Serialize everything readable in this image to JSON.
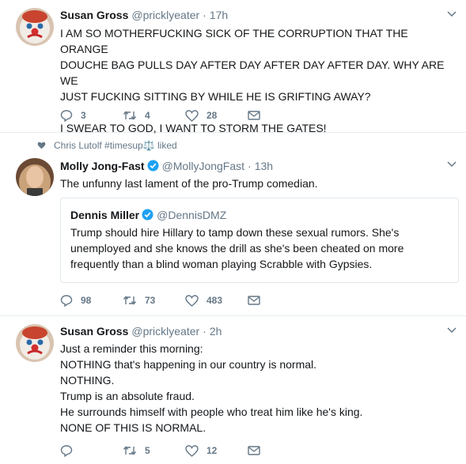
{
  "tweets": [
    {
      "name": "Susan Gross",
      "handle": "@pricklyeater",
      "separator": "·",
      "time": "17h",
      "lines": [
        "I AM SO MOTHERFUCKING SICK OF THE CORRUPTION THAT THE ORANGE",
        "DOUCHE BAG PULLS DAY AFTER DAY AFTER DAY AFTER DAY. WHY ARE WE",
        "JUST FUCKING SITTING BY WHILE HE IS GRIFTING AWAY?",
        "",
        "I SWEAR TO GOD, I WANT TO STORM THE GATES!"
      ],
      "replies": "3",
      "retweets": "4",
      "likes": "28"
    },
    {
      "social_context": "Chris Lutolf #timesup⚖️ liked",
      "name": "Molly Jong-Fast",
      "handle": "@MollyJongFast",
      "separator": "·",
      "time": "13h",
      "text": "The unfunny last lament of the pro-Trump comedian.",
      "quote": {
        "name": "Dennis Miller",
        "handle": "@DennisDMZ",
        "lines": [
          "Trump should hire Hillary to tamp down these sexual rumors. She's",
          "unemployed and she knows the drill as she's been cheated on more",
          "frequently than a blind woman playing Scrabble with Gypsies."
        ]
      },
      "replies": "98",
      "retweets": "73",
      "likes": "483"
    },
    {
      "name": "Susan Gross",
      "handle": "@pricklyeater",
      "separator": "·",
      "time": "2h",
      "lines": [
        "Just a reminder this morning:",
        "NOTHING that's happening in our country is normal.",
        "NOTHING.",
        "Trump is an absolute fraud.",
        "He surrounds himself with people who treat him like he's king.",
        "NONE OF THIS IS NORMAL."
      ],
      "replies": "",
      "retweets": "5",
      "likes": "12"
    }
  ],
  "colors": {
    "text": "#14171a",
    "secondary": "#657786",
    "border": "#e6ecf0",
    "verified": "#1da1f2",
    "like_heart": "#e0245e"
  }
}
